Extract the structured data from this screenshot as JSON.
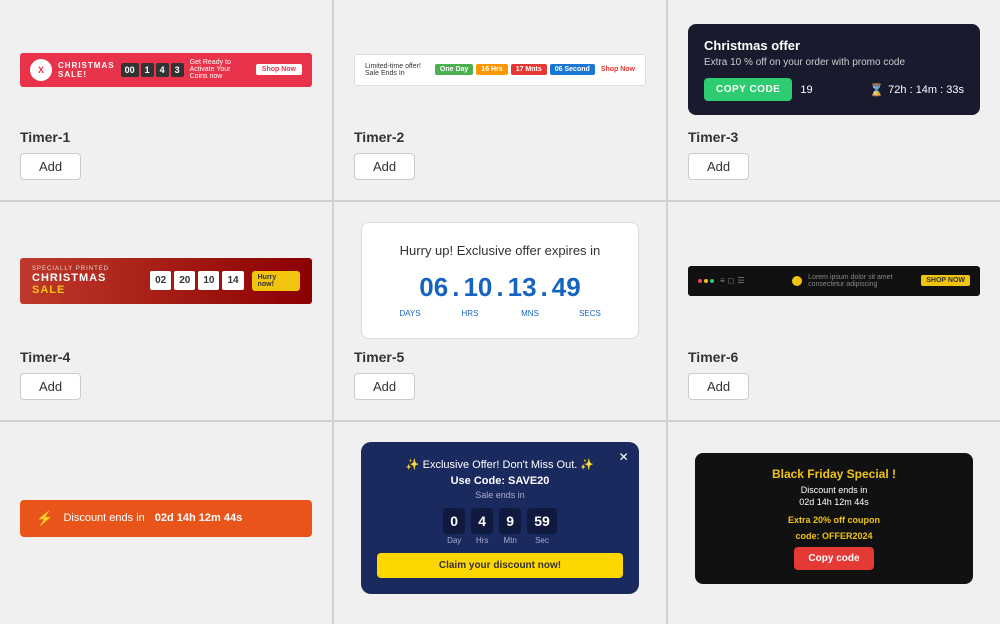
{
  "timers": [
    {
      "id": "timer1",
      "label": "Timer-1",
      "add_label": "Add",
      "bar": {
        "logo": "X",
        "title": "CHRISTMAS SALE!",
        "boxes": [
          "00",
          "1",
          "4",
          "3"
        ],
        "text": "Get Ready to Activate Your Coins now",
        "shop": "Shop Now"
      }
    },
    {
      "id": "timer2",
      "label": "Timer-2",
      "add_label": "Add",
      "bar": {
        "text": "Limited-time offer! Sale Ends In",
        "blocks": [
          "One Day",
          "16 Hrs",
          "17 Mnts",
          "06 Second"
        ],
        "shop": "Shop Now"
      }
    },
    {
      "id": "timer3",
      "label": "Timer-3",
      "add_label": "Add",
      "card": {
        "title": "Christmas offer",
        "subtitle": "Extra 10 % off on your order with promo code",
        "copy_label": "COPY CODE",
        "code": "19",
        "countdown": "72h : 14m : 33s"
      }
    },
    {
      "id": "timer4",
      "label": "Timer-4",
      "add_label": "Add",
      "bar": {
        "special": "SPECIALLY PRINTED",
        "title_white": "CHRISTMAS ",
        "title_yellow": "SALE",
        "boxes": [
          "02",
          "20",
          "10",
          "14"
        ],
        "hurry": "Hurry now!"
      }
    },
    {
      "id": "timer5",
      "label": "Timer-5",
      "add_label": "Add",
      "card": {
        "heading": "Hurry up! Exclusive offer expires in",
        "days": "06",
        "hrs": "10",
        "mns": "13",
        "secs": "49",
        "label_days": "DAYS",
        "label_hrs": "HRS",
        "label_mns": "MNS",
        "label_secs": "SECS"
      }
    },
    {
      "id": "timer6",
      "label": "Timer-6",
      "add_label": "Add",
      "bar": {
        "text": "Lorem ipsum dolor sit amet consectetur adipiscing",
        "box_text": "SHOP NOW"
      }
    },
    {
      "id": "timer7",
      "label": "",
      "add_label": "",
      "bar": {
        "bolt": "⚡",
        "text": "Discount ends in",
        "countdown": "02d 14h 12m 44s"
      }
    },
    {
      "id": "timer8",
      "label": "",
      "add_label": "",
      "card": {
        "emoji": "✨ Exclusive Offer! Don't Miss Out. ✨",
        "title": "Use Code: SAVE20",
        "subtitle": "Sale ends in",
        "digits": [
          {
            "value": "0",
            "unit": "Day"
          },
          {
            "value": "4",
            "unit": "Hrs"
          },
          {
            "value": "9",
            "unit": "Mtn"
          },
          {
            "value": "59",
            "unit": "Sec"
          }
        ],
        "btn_label": "Claim your discount now!"
      }
    },
    {
      "id": "timer9",
      "label": "",
      "add_label": "",
      "card": {
        "title": "Black Friday Special !",
        "subtitle": "Discount ends in",
        "countdown": "02d 14h 12m 44s",
        "coupon_text": "Extra 20% off coupon",
        "coupon_code": "code: OFFER2024",
        "btn_label": "Copy code"
      }
    }
  ],
  "colors": {
    "timer1_bg": "#e8334a",
    "timer3_bg": "#1a1a2e",
    "timer3_copy": "#2ecc71",
    "timer4_bg": "#c0392b",
    "timer5_blue": "#1565c0",
    "timer7_bg": "#e8541a",
    "timer8_bg": "#1a2a5e",
    "timer9_bg": "#111"
  }
}
